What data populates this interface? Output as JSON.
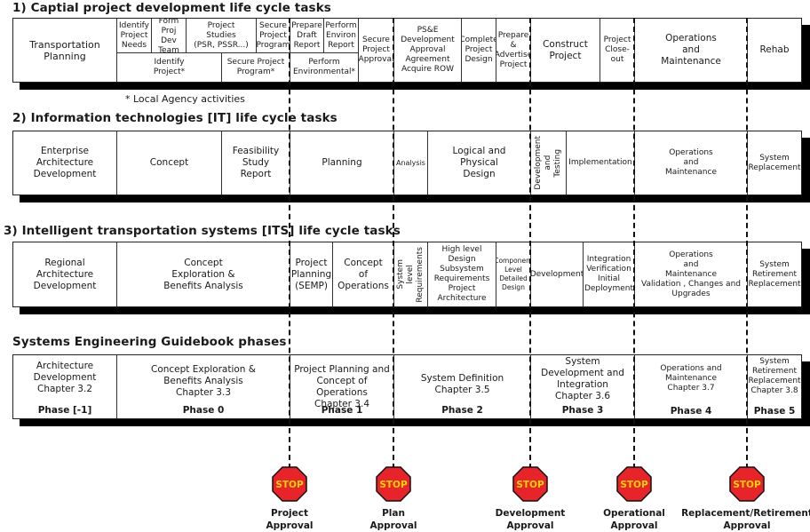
{
  "sections": {
    "capital": {
      "title": "1)  Captial project development life cycle tasks",
      "note": "* Local Agency activities",
      "top_cells": [
        {
          "label": "Transportation\nPlanning"
        },
        {
          "label": "Identify\nProject\nNeeds"
        },
        {
          "label": "Form\nProj Dev\nTeam"
        },
        {
          "label": "Project\nStudies\n(PSR, PSSR...)"
        },
        {
          "label": "Secure\nProject\nProgram"
        },
        {
          "label": "Prepare\nDraft\nReport"
        },
        {
          "label": "Perform\nEnviron\nReport"
        },
        {
          "label": "Secure\nProject\nApproval"
        },
        {
          "label": "PS&E\nDevelopment\nApproval\nAgreement\nAcquire ROW"
        },
        {
          "label": "Complete\nProject\nDesign"
        },
        {
          "label": "Prepare &\nAdvertise\nProject"
        },
        {
          "label": "Construct\nProject"
        },
        {
          "label": "Project\nClose-out"
        },
        {
          "label": "Operations\nand\nMaintenance"
        },
        {
          "label": "Rehab"
        }
      ],
      "bottom_cells": [
        {
          "label": "Identify\nProject*"
        },
        {
          "label": "Secure Project\nProgram*"
        },
        {
          "label": "Perform\nEnvironmental*"
        }
      ]
    },
    "it": {
      "title": "2) Information technologies [IT] life cycle tasks",
      "cells": [
        {
          "label": "Enterprise\nArchitecture\nDevelopment"
        },
        {
          "label": "Concept"
        },
        {
          "label": "Feasibility\nStudy\nReport"
        },
        {
          "label": "Planning"
        },
        {
          "label": "Analysis"
        },
        {
          "label": "Logical and\nPhysical\nDesign"
        },
        {
          "label": "Development\nand\nTesting"
        },
        {
          "label": "Implementation"
        },
        {
          "label": "Operations\nand\nMaintenance"
        },
        {
          "label": "System\nReplacement"
        }
      ]
    },
    "its": {
      "title": "3) Intelligent transportation systems [ITS] life cycle tasks",
      "cells": [
        {
          "label": "Regional\nArchitecture\nDevelopment"
        },
        {
          "label": "Concept\nExploration &\nBenefits Analysis"
        },
        {
          "label": "Project\nPlanning\n(SEMP)"
        },
        {
          "label": "Concept\nof\nOperations"
        },
        {
          "label": "System\nlevel\nRequirements"
        },
        {
          "label": "High level Design\nSubsystem\nRequirements\nProject\nArchitecture"
        },
        {
          "label": "Component\nLevel\nDetailed\nDesign"
        },
        {
          "label": "Development"
        },
        {
          "label": "Integration\nVerification\nInitial\nDeployment"
        },
        {
          "label": "Operations\nand\nMaintenance\nValidation , Changes and\nUpgrades"
        },
        {
          "label": "System\nRetirement\nReplacement"
        }
      ]
    },
    "seg": {
      "title": "Systems Engineering Guidebook phases",
      "cells": [
        {
          "label": "Architecture\nDevelopment\nChapter 3.2",
          "phase": "Phase [-1]"
        },
        {
          "label": "Concept Exploration &\nBenefits Analysis\nChapter 3.3",
          "phase": "Phase 0"
        },
        {
          "label": "Project Planning and\nConcept of Operations\nChapter 3.4",
          "phase": "Phase 1"
        },
        {
          "label": "System Definition\nChapter 3.5",
          "phase": "Phase 2"
        },
        {
          "label": "System\nDevelopment and\nIntegration\nChapter 3.6",
          "phase": "Phase 3"
        },
        {
          "label": "Operations and\nMaintenance\nChapter 3.7",
          "phase": "Phase 4"
        },
        {
          "label": "System\nRetirement\nReplacement\nChapter 3.8",
          "phase": "Phase 5"
        }
      ]
    }
  },
  "gates": [
    {
      "sign": "STOP",
      "label": "Project\nApproval"
    },
    {
      "sign": "STOP",
      "label": "Plan\nApproval"
    },
    {
      "sign": "STOP",
      "label": "Development\nApproval"
    },
    {
      "sign": "STOP",
      "label": "Operational\nApproval"
    },
    {
      "sign": "STOP",
      "label": "Replacement/Retirement\nApproval"
    }
  ],
  "colors": {
    "stop_fill": "#e8242b",
    "stop_text": "#ffd200",
    "shadow": "#000000"
  }
}
